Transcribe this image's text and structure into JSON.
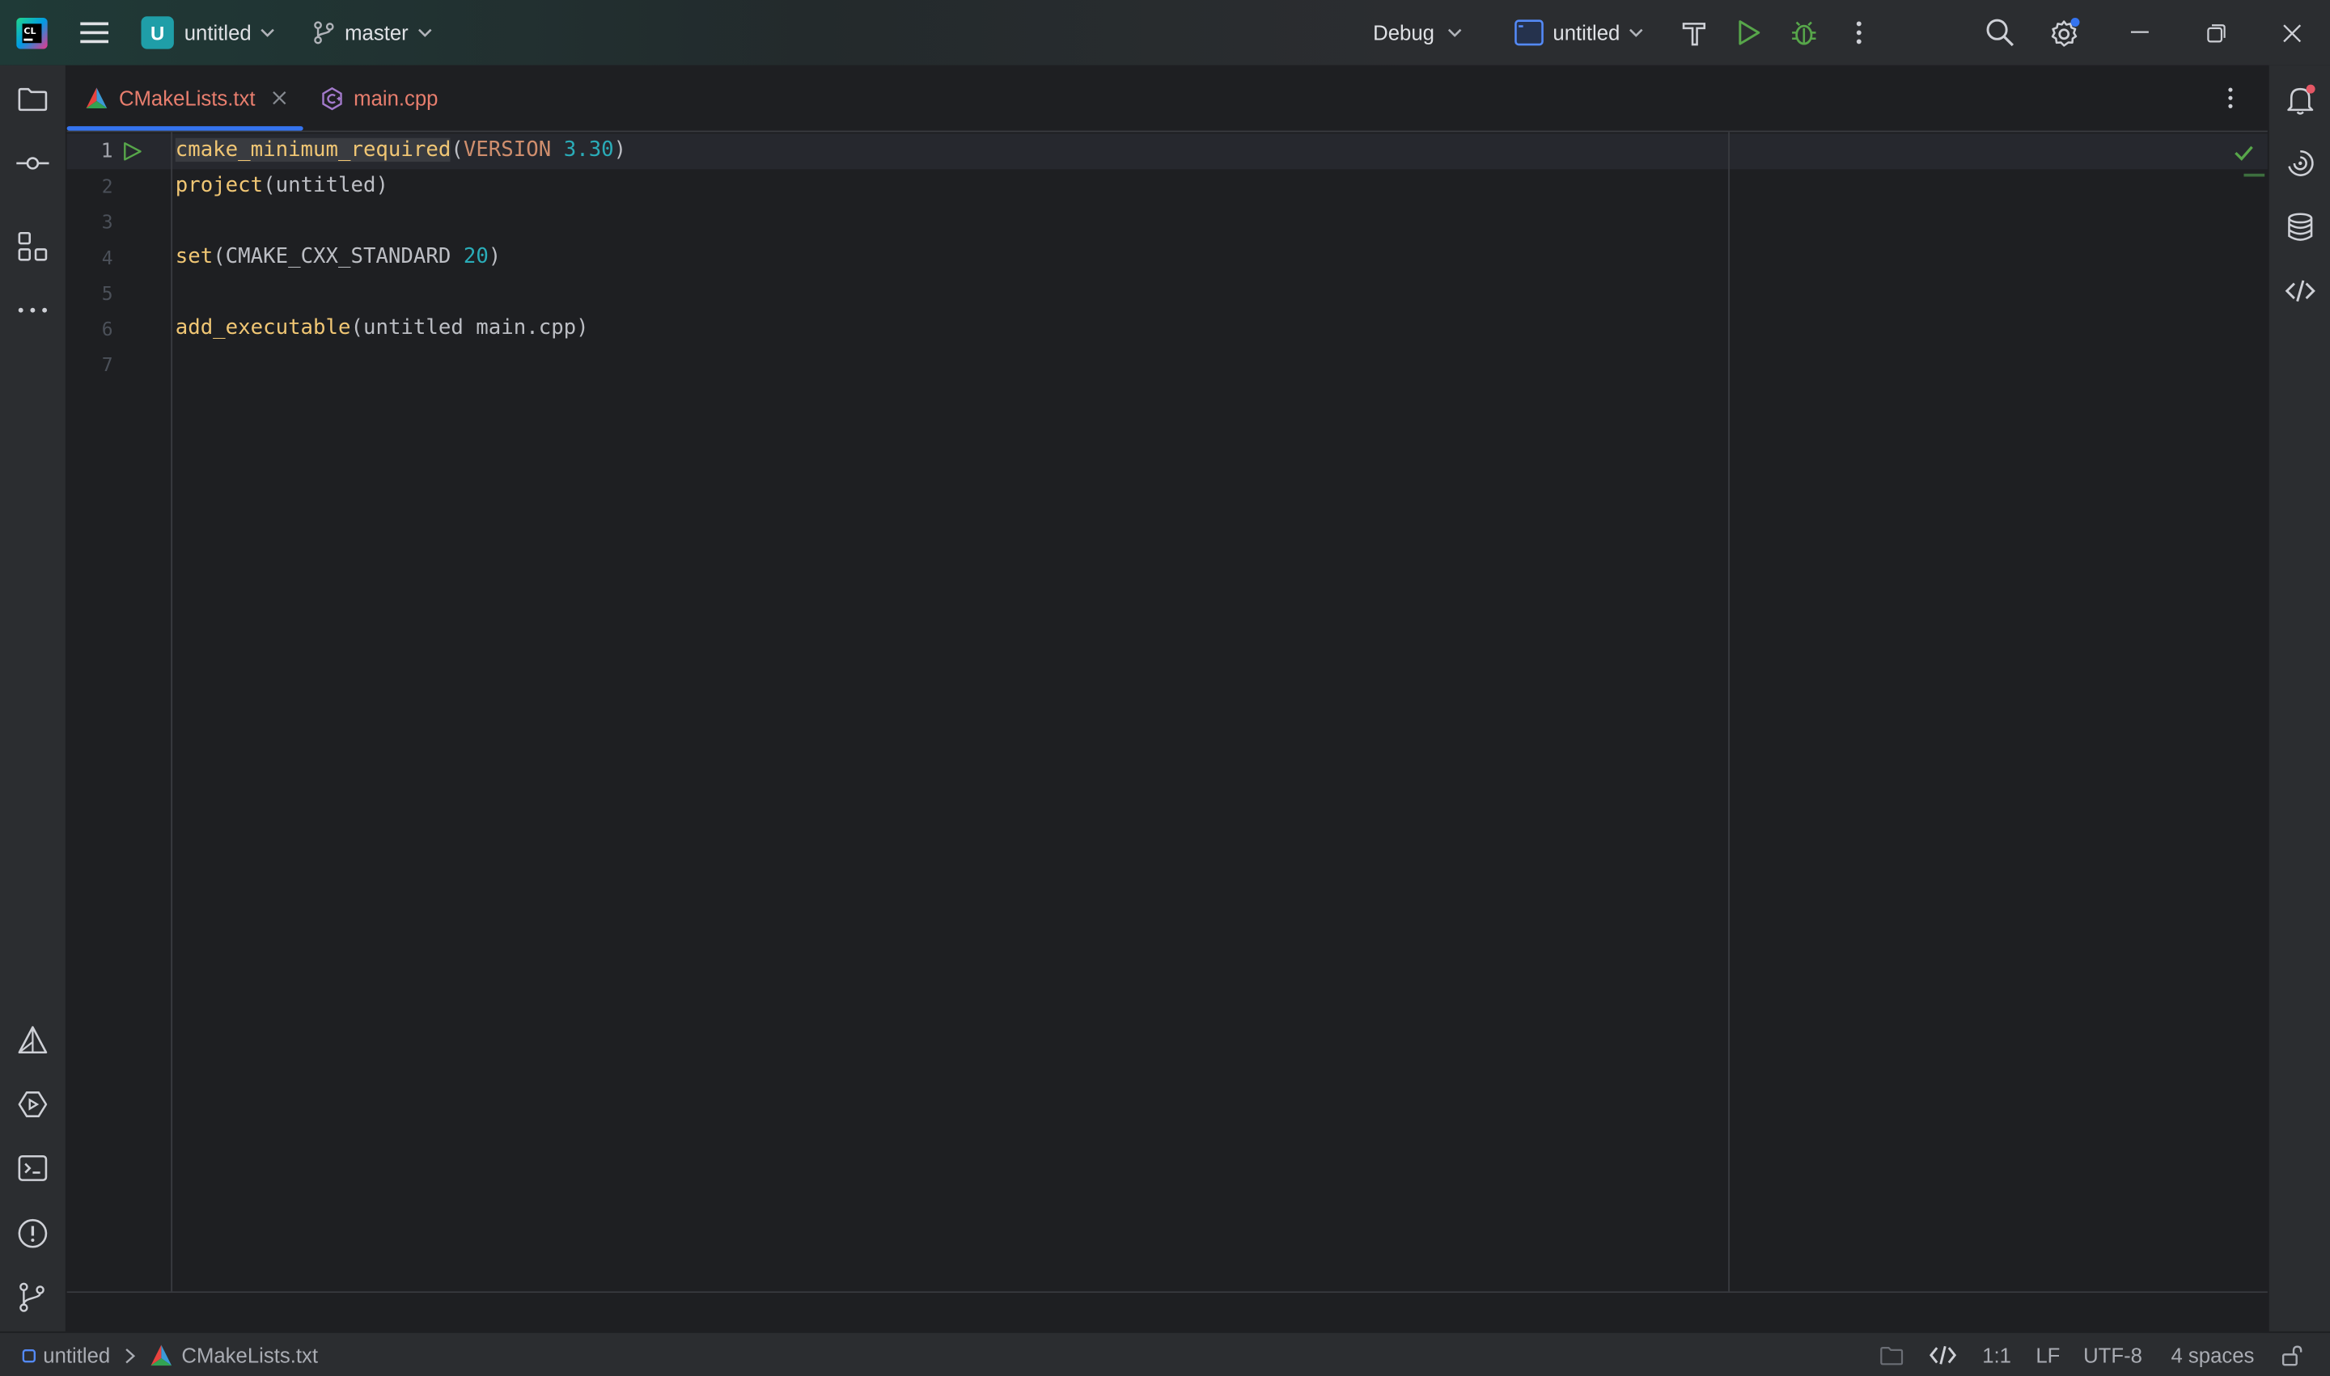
{
  "titlebar": {
    "project_initial": "U",
    "project_name": "untitled",
    "branch": "master",
    "run_config": "Debug",
    "target": "untitled",
    "colors": {
      "project_badge": "#1f9ea8",
      "run_green": "#57a64a",
      "accent": "#3574f0"
    }
  },
  "tabs": [
    {
      "label": "CMakeLists.txt",
      "active": true,
      "icon": "cmake-icon"
    },
    {
      "label": "main.cpp",
      "active": false,
      "icon": "cpp-file-icon"
    }
  ],
  "editor": {
    "line_numbers": [
      "1",
      "2",
      "3",
      "4",
      "5",
      "6",
      "7"
    ],
    "lines": [
      {
        "tokens": [
          [
            "cmake_minimum_required",
            "fn"
          ],
          [
            "(",
            "p"
          ],
          [
            "VERSION",
            "vers"
          ],
          [
            " ",
            "p"
          ],
          [
            "3.30",
            "num"
          ],
          [
            ")",
            "p"
          ]
        ]
      },
      {
        "tokens": [
          [
            "project",
            "fn"
          ],
          [
            "(untitled)",
            "p"
          ]
        ]
      },
      {
        "tokens": []
      },
      {
        "tokens": [
          [
            "set",
            "fn"
          ],
          [
            "(CMAKE_CXX_STANDARD ",
            "p"
          ],
          [
            "20",
            "num"
          ],
          [
            ")",
            "p"
          ]
        ]
      },
      {
        "tokens": []
      },
      {
        "tokens": [
          [
            "add_executable",
            "fn"
          ],
          [
            "(untitled main.cpp)",
            "p"
          ]
        ]
      },
      {
        "tokens": []
      }
    ]
  },
  "statusbar": {
    "project": "untitled",
    "file": "CMakeLists.txt",
    "position": "1:1",
    "line_ending": "LF",
    "encoding": "UTF-8",
    "indent": "4 spaces"
  }
}
